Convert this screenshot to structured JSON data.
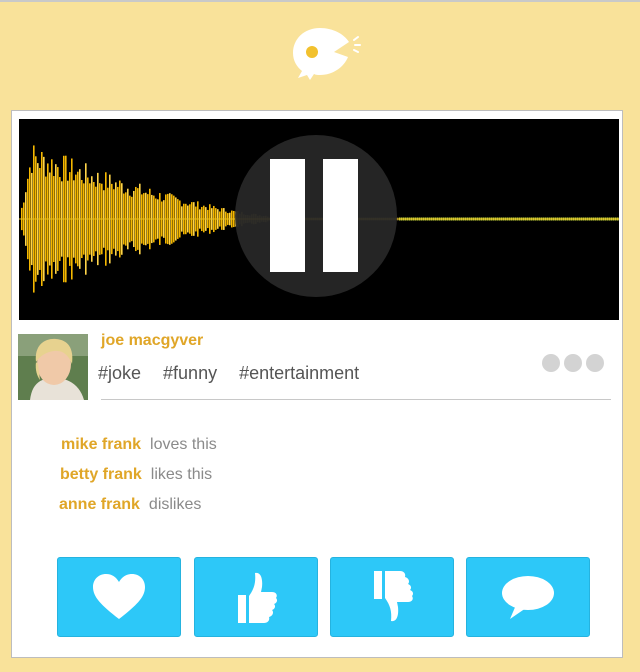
{
  "app": {
    "logo_icon": "chick-logo-icon",
    "background_color": "#f9e29a",
    "accent_color": "#e0a628",
    "button_color": "#2dc8f8"
  },
  "post": {
    "author": "joe macgyver",
    "avatar_icon": "user-avatar",
    "tags": [
      "#joke",
      "#funny",
      "#entertainment"
    ],
    "more_icon": "more-dots-icon",
    "player": {
      "state": "playing",
      "control_icon": "pause-icon",
      "progress": 0.36
    }
  },
  "reactions": [
    {
      "name": "mike frank",
      "verb": "loves this"
    },
    {
      "name": "betty frank",
      "verb": "likes this"
    },
    {
      "name": "anne frank",
      "verb": "dislikes"
    }
  ],
  "actions": [
    {
      "icon": "heart-icon",
      "name": "love-button"
    },
    {
      "icon": "thumbs-up-icon",
      "name": "like-button"
    },
    {
      "icon": "thumbs-down-icon",
      "name": "dislike-button"
    },
    {
      "icon": "comment-icon",
      "name": "comment-button"
    }
  ]
}
